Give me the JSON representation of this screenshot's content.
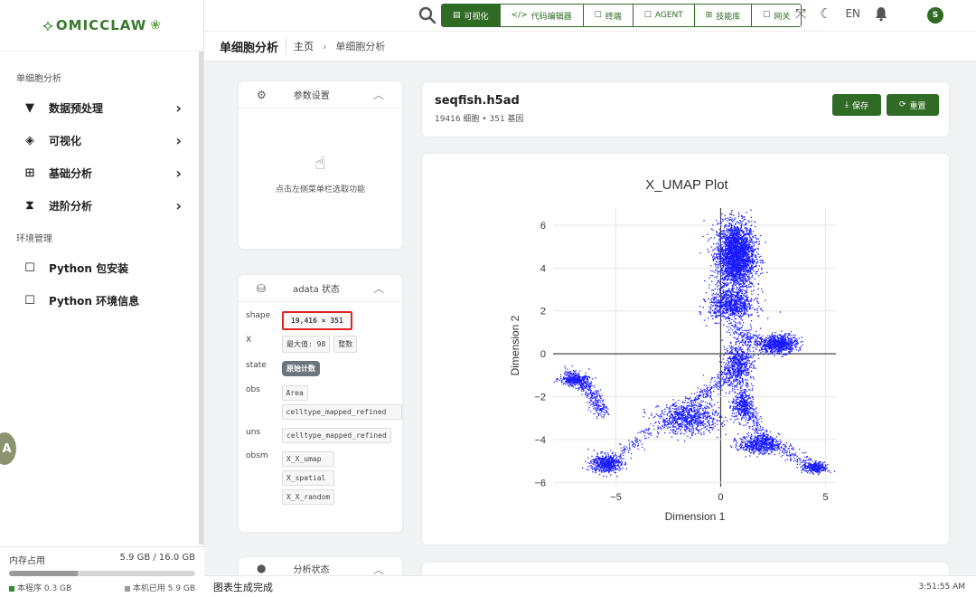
{
  "app": {
    "logo_text": "OMICCLAW"
  },
  "sidebar": {
    "section1": "单细胞分析",
    "items": [
      {
        "label": "数据预处理"
      },
      {
        "label": "可视化"
      },
      {
        "label": "基础分析"
      },
      {
        "label": "进阶分析"
      }
    ],
    "section2": "环境管理",
    "env_items": [
      {
        "label": "Python 包安装"
      },
      {
        "label": "Python 环境信息"
      }
    ],
    "memory": {
      "label": "内存占用",
      "value": "5.9 GB / 16.0 GB",
      "fraction": 0.369,
      "program": "本程序 0.3 GB",
      "machine": "本机已用 5.9 GB"
    },
    "avatar_letter": "A"
  },
  "topbar": {
    "tabs": [
      {
        "label": "可视化",
        "icon": "chart-icon",
        "active": true
      },
      {
        "label": "代码编辑器",
        "icon": "code-icon"
      },
      {
        "label": "终端",
        "icon": "terminal-icon"
      },
      {
        "label": "AGENT",
        "icon": "agent-icon"
      },
      {
        "label": "技能库",
        "icon": "grid-icon"
      },
      {
        "label": "网关",
        "icon": "gateway-icon"
      }
    ],
    "lang": "EN",
    "user_initial": "S"
  },
  "breadcrumb": {
    "title": "单细胞分析",
    "home": "主页",
    "current": "单细胞分析"
  },
  "params_card": {
    "title": "参数设置",
    "placeholder": "点击左侧菜单栏选取功能"
  },
  "adata_card": {
    "title": "adata 状态",
    "shape_key": "shape",
    "shape": "19,416 × 351",
    "x_key": "X",
    "x_max": "最大值: 98",
    "x_type": "整数",
    "state_key": "state",
    "state": "原始计数",
    "obs_key": "obs",
    "obs": [
      "Area",
      "celltype_mapped_refined"
    ],
    "uns_key": "uns",
    "uns": [
      "celltype_mapped_refined"
    ],
    "obsm_key": "obsm",
    "obsm": [
      "X_X_umap",
      "X_spatial",
      "X_X_random"
    ]
  },
  "analysis_card": {
    "title": "分析状态"
  },
  "file_card": {
    "name": "seqfish.h5ad",
    "info": "19416 细胞 • 351 基因",
    "save": "保存",
    "reset": "重置"
  },
  "chart_data": {
    "type": "scatter",
    "title": "X_UMAP Plot",
    "xlabel": "Dimension 1",
    "ylabel": "Dimension 2",
    "xlim": [
      -8,
      5.5
    ],
    "ylim": [
      -6.2,
      6.8
    ],
    "xticks": [
      -5,
      0,
      5
    ],
    "yticks": [
      -6,
      -4,
      -2,
      0,
      2,
      4,
      6
    ],
    "color": "#1a1aff",
    "grid": true,
    "n_points": 19416,
    "clusters": [
      {
        "cx": 0.7,
        "cy": 4.6,
        "sx": 0.75,
        "sy": 1.3,
        "n": 2600
      },
      {
        "cx": 0.5,
        "cy": 2.3,
        "sx": 0.9,
        "sy": 0.6,
        "n": 800
      },
      {
        "cx": 2.8,
        "cy": 0.5,
        "sx": 0.7,
        "sy": 0.35,
        "n": 500
      },
      {
        "cx": 0.8,
        "cy": -0.5,
        "sx": 0.6,
        "sy": 0.9,
        "n": 600
      },
      {
        "cx": -1.5,
        "cy": -3.0,
        "sx": 1.2,
        "sy": 0.6,
        "n": 700
      },
      {
        "cx": -5.5,
        "cy": -5.1,
        "sx": 0.6,
        "sy": 0.35,
        "n": 500
      },
      {
        "cx": -7.0,
        "cy": -1.2,
        "sx": 0.6,
        "sy": 0.2,
        "n": 250
      },
      {
        "cx": 1.8,
        "cy": -4.2,
        "sx": 0.8,
        "sy": 0.35,
        "n": 500
      },
      {
        "cx": 4.5,
        "cy": -5.3,
        "sx": 0.5,
        "sy": 0.2,
        "n": 250
      },
      {
        "cx": 1.0,
        "cy": -2.4,
        "sx": 0.4,
        "sy": 0.6,
        "n": 300
      }
    ]
  },
  "status": {
    "message": "图表生成完成",
    "time": "3:51:55 AM"
  }
}
